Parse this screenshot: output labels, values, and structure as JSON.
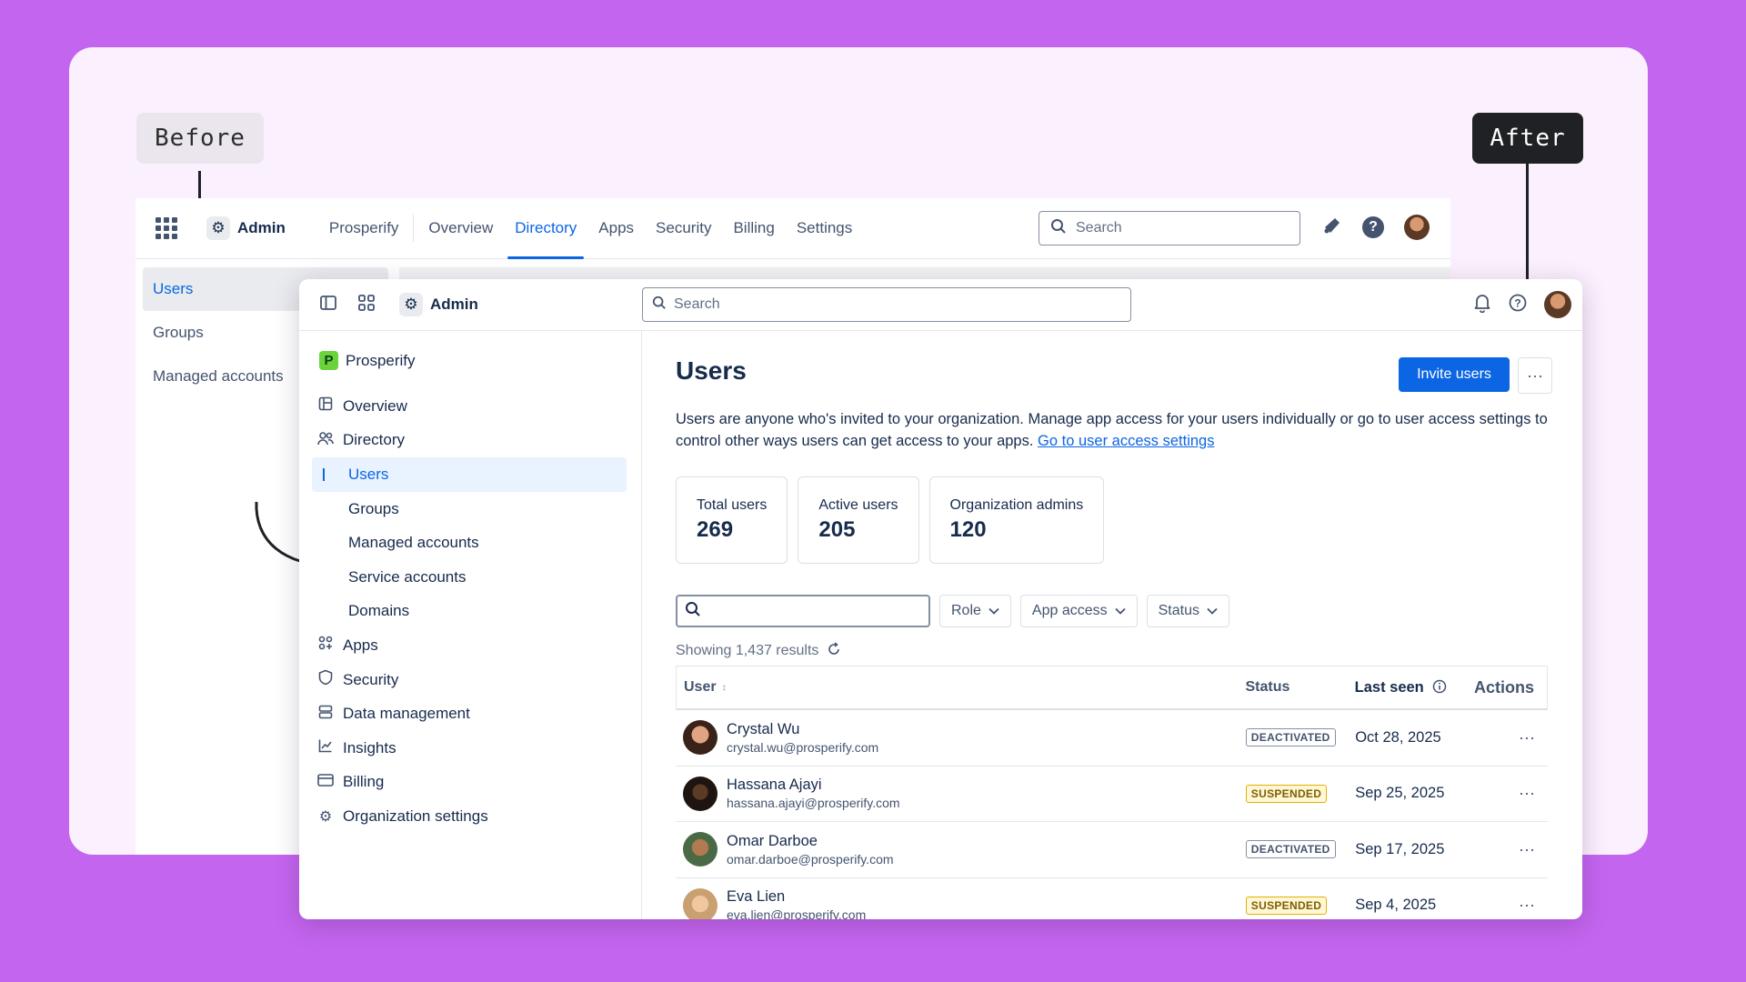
{
  "labels": {
    "before": "Before",
    "after": "After"
  },
  "before": {
    "admin_label": "Admin",
    "nav": [
      "Prosperify",
      "Overview",
      "Directory",
      "Apps",
      "Security",
      "Billing",
      "Settings"
    ],
    "active_nav": "Directory",
    "search_placeholder": "Search",
    "sidebar": [
      "Users",
      "Groups",
      "Managed accounts"
    ]
  },
  "after": {
    "admin_label": "Admin",
    "search_placeholder": "Search",
    "org_name": "Prosperify",
    "nav": {
      "overview": "Overview",
      "directory": "Directory",
      "users": "Users",
      "groups": "Groups",
      "managed_accounts": "Managed accounts",
      "service_accounts": "Service accounts",
      "domains": "Domains",
      "apps": "Apps",
      "security": "Security",
      "data_management": "Data management",
      "insights": "Insights",
      "billing": "Billing",
      "organization_settings": "Organization settings"
    },
    "page_title": "Users",
    "invite_button": "Invite users",
    "more_button": "···",
    "description": "Users are anyone who's invited to your organization. Manage app access for your users individually or go to user access settings to control other ways users can get access to your apps.",
    "description_link": "Go to user access settings",
    "stats": [
      {
        "label": "Total users",
        "value": "269"
      },
      {
        "label": "Active users",
        "value": "205"
      },
      {
        "label": "Organization admins",
        "value": "120"
      }
    ],
    "filters": {
      "role": "Role",
      "app_access": "App access",
      "status": "Status"
    },
    "results_text": "Showing 1,437 results",
    "table": {
      "headers": {
        "user": "User",
        "status": "Status",
        "last_seen": "Last seen",
        "actions": "Actions"
      },
      "rows": [
        {
          "name": "Crystal Wu",
          "email": "crystal.wu@prosperify.com",
          "status": "DEACTIVATED",
          "last_seen": "Oct 28, 2025",
          "action": "···"
        },
        {
          "name": "Hassana Ajayi",
          "email": "hassana.ajayi@prosperify.com",
          "status": "SUSPENDED",
          "last_seen": "Sep 25, 2025",
          "action": "···"
        },
        {
          "name": "Omar Darboe",
          "email": "omar.darboe@prosperify.com",
          "status": "DEACTIVATED",
          "last_seen": "Sep 17, 2025",
          "action": "···"
        },
        {
          "name": "Eva Lien",
          "email": "eva.lien@prosperify.com",
          "status": "SUSPENDED",
          "last_seen": "Sep 4, 2025",
          "action": "···"
        }
      ]
    }
  },
  "colors": {
    "background": "#c465ef",
    "accent": "#0c66e4",
    "deactivated": "#44546f",
    "suspended": "#7f5f01"
  }
}
